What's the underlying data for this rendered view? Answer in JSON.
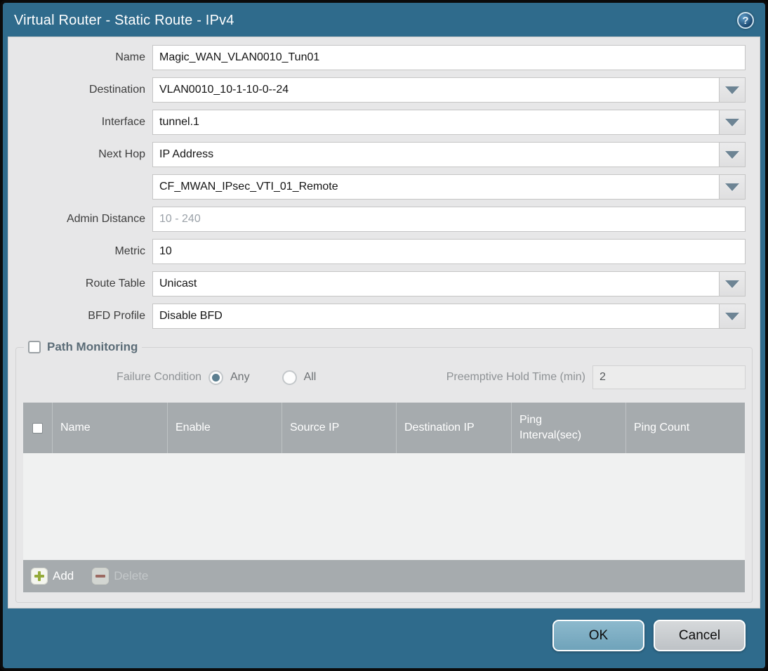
{
  "dialog": {
    "title": "Virtual Router - Static Route - IPv4"
  },
  "form": {
    "fields": [
      {
        "label": "Name",
        "value": "Magic_WAN_VLAN0010_Tun01",
        "type": "text"
      },
      {
        "label": "Destination",
        "value": "VLAN0010_10-1-10-0--24",
        "type": "dropdown"
      },
      {
        "label": "Interface",
        "value": "tunnel.1",
        "type": "dropdown"
      },
      {
        "label": "Next Hop",
        "value": "IP Address",
        "type": "dropdown"
      },
      {
        "label": "",
        "value": "CF_MWAN_IPsec_VTI_01_Remote",
        "type": "dropdown"
      },
      {
        "label": "Admin Distance",
        "value": "",
        "placeholder": "10 - 240",
        "type": "text"
      },
      {
        "label": "Metric",
        "value": "10",
        "type": "text"
      },
      {
        "label": "Route Table",
        "value": "Unicast",
        "type": "dropdown"
      },
      {
        "label": "BFD Profile",
        "value": "Disable BFD",
        "type": "dropdown"
      }
    ]
  },
  "path_monitoring": {
    "title": "Path Monitoring",
    "enabled": false,
    "failure_condition_label": "Failure Condition",
    "failure_options": [
      {
        "label": "Any",
        "selected": true
      },
      {
        "label": "All",
        "selected": false
      }
    ],
    "preemptive_label": "Preemptive Hold Time (min)",
    "preemptive_value": "2",
    "table": {
      "columns": [
        "Name",
        "Enable",
        "Source IP",
        "Destination IP",
        "Ping Interval(sec)",
        "Ping Count"
      ],
      "rows": []
    },
    "add_label": "Add",
    "delete_label": "Delete"
  },
  "footer": {
    "ok_label": "OK",
    "cancel_label": "Cancel"
  },
  "icons": {
    "help": "?",
    "chevron_down": "chevron-down",
    "add_plus": "plus",
    "delete_minus": "minus"
  },
  "colors": {
    "titlebar_teal": "#2f6b8c",
    "panel_gray": "#e7e7e8",
    "table_header_gray": "#a6abae",
    "ok_button_blue": "#7fb0c6",
    "radio_selected": "#5b7e90",
    "add_green": "#94ab3a",
    "delete_red": "#9a5a50"
  }
}
